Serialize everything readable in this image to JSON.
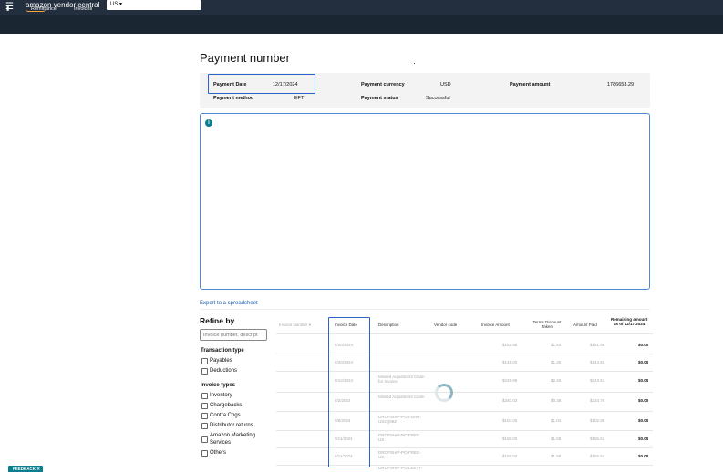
{
  "topbar": {
    "logo_text": "amazon vendor central",
    "marketplace": "US ▾"
  },
  "nav": {
    "items": [
      "Remittance",
      "Invoices",
      "Financial Scorecard"
    ]
  },
  "page": {
    "title": "Payment number"
  },
  "summary": {
    "payment_date_label": "Payment Date",
    "payment_date": "12/17/2024",
    "payment_method_label": "Payment method",
    "payment_method": "EFT",
    "currency_label": "Payment currency",
    "currency": "USD",
    "status_label": "Payment status",
    "status": "Successful",
    "amount_label": "Payment amount",
    "amount": "1786653.29"
  },
  "export_link": "Export to a spreadsheet",
  "refine": {
    "title": "Refine by",
    "search_placeholder": "Invoice number, descript",
    "transaction_type_title": "Transaction type",
    "transaction_types": [
      "Payables",
      "Deductions"
    ],
    "invoice_types_title": "Invoice types",
    "invoice_types": [
      "Inventory",
      "Chargebacks",
      "Contra Cogs",
      "Distributor returns",
      "Amazon Marketing Services",
      "Others"
    ]
  },
  "table": {
    "headers": {
      "invoice_number": "Invoice Number ▾",
      "invoice_date": "Invoice Date",
      "description": "Description",
      "vendor_code": "Vendor code",
      "invoice_amount": "Invoice Amount",
      "terms_discount": "Terms Discount Taken",
      "amount_paid": "Amount Paid",
      "remaining_line1": "Remaining amount",
      "remaining_line2": "as of 12/17/2024"
    },
    "rows": [
      {
        "date": "8/20/2024",
        "desc": "",
        "inv_amt": "$152.98",
        "disc": "$1.53",
        "paid": "$151.46",
        "remain": "$0.00"
      },
      {
        "date": "8/20/2024",
        "desc": "",
        "inv_amt": "$145.00",
        "disc": "$1.45",
        "paid": "$143.55",
        "remain": "$0.00"
      },
      {
        "date": "8/12/2024",
        "desc": "Missed Adjustment Claim for Invoice",
        "inv_amt": "$245.99",
        "disc": "$2.46",
        "paid": "$243.53",
        "remain": "$0.00"
      },
      {
        "date": "8/2/2024",
        "desc": "Missed Adjustment Claim",
        "inv_amt": "$340.02",
        "disc": "$3.38",
        "paid": "$334.76",
        "remain": "$0.00"
      },
      {
        "date": "9/8/2024",
        "desc": "DROPSHIP-PO-FDRR-US2Q86Z",
        "inv_amt": "$104.00",
        "disc": "$1.04",
        "paid": "$102.96",
        "remain": "$0.00"
      },
      {
        "date": "9/11/2024",
        "desc": "DROPSHIP-PO-FREE-US",
        "inv_amt": "$158.00",
        "disc": "$1.58",
        "paid": "$156.62",
        "remain": "$0.00"
      },
      {
        "date": "9/11/2024",
        "desc": "DROPSHIP-PO-FREE-US",
        "inv_amt": "$158.00",
        "disc": "$1.58",
        "paid": "$156.62",
        "remain": "$0.00"
      },
      {
        "date": "",
        "desc": "DROPSHIP-PO-LEETT-",
        "inv_amt": "",
        "disc": "",
        "paid": "",
        "remain": ""
      }
    ]
  },
  "feedback": "FEEDBACK ✕"
}
